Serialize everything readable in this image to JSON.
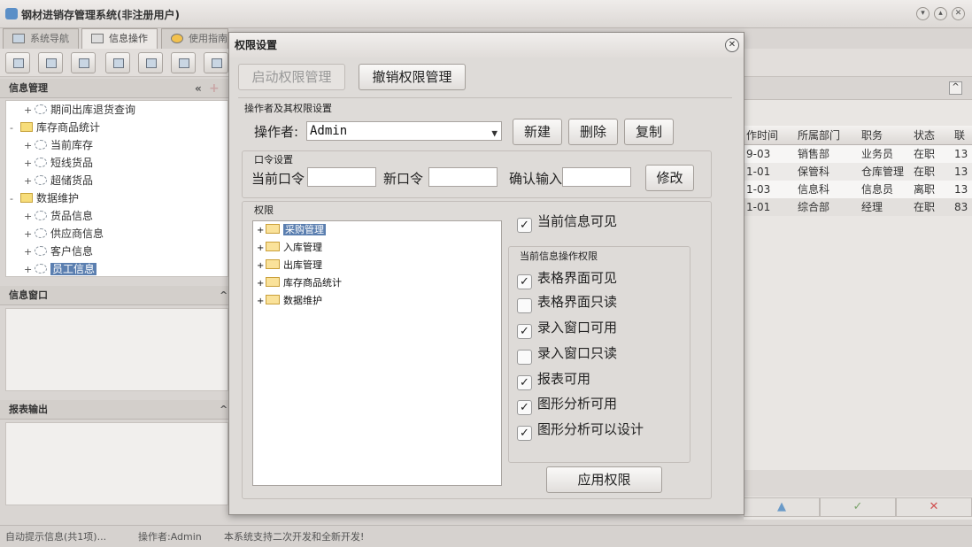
{
  "app": {
    "title": "钢材进销存管理系统(非注册用户)"
  },
  "main_tabs": [
    {
      "label": "系统导航"
    },
    {
      "label": "信息操作"
    },
    {
      "label": "使用指南"
    }
  ],
  "left": {
    "info_panel_title": "信息管理",
    "tree": [
      {
        "label": "期间出库退货查询"
      },
      {
        "label": "库存商品统计"
      },
      {
        "label": "当前库存"
      },
      {
        "label": "短线货品"
      },
      {
        "label": "超储货品"
      },
      {
        "label": "数据维护"
      },
      {
        "label": "货品信息"
      },
      {
        "label": "供应商信息"
      },
      {
        "label": "客户信息"
      },
      {
        "label": "员工信息"
      }
    ],
    "info_window_title": "信息窗口",
    "report_title": "报表输出"
  },
  "grid": {
    "headers": [
      "作时间",
      "所属部门",
      "职务",
      "状态",
      "联"
    ],
    "rows": [
      [
        "9-03",
        "销售部",
        "业务员",
        "在职",
        "13"
      ],
      [
        "1-01",
        "保管科",
        "仓库管理",
        "在职",
        "13"
      ],
      [
        "1-03",
        "信息科",
        "信息员",
        "离职",
        "13"
      ],
      [
        "1-01",
        "综合部",
        "经理",
        "在职",
        "83"
      ]
    ]
  },
  "status": {
    "hint": "自动提示信息(共1项)...",
    "operator": "操作者:Admin",
    "note": "本系统支持二次开发和全新开发!"
  },
  "dialog": {
    "title": "权限设置",
    "enable_btn": "启动权限管理",
    "revoke_btn": "撤销权限管理",
    "operator_group": "操作者及其权限设置",
    "operator_label": "操作者:",
    "operator_value": "Admin",
    "new_btn": "新建",
    "delete_btn": "删除",
    "copy_btn": "复制",
    "password_group": "口令设置",
    "current_pw_label": "当前口令",
    "new_pw_label": "新口令",
    "confirm_label": "确认输入",
    "modify_btn": "修改",
    "perm_group": "权限",
    "perm_tree": [
      {
        "label": "采购管理"
      },
      {
        "label": "入库管理"
      },
      {
        "label": "出库管理"
      },
      {
        "label": "库存商品统计"
      },
      {
        "label": "数据维护"
      }
    ],
    "current_visible": {
      "label": "当前信息可见",
      "checked": true
    },
    "ops_group": "当前信息操作权限",
    "ops": [
      {
        "label": "表格界面可见",
        "checked": true
      },
      {
        "label": "表格界面只读",
        "checked": false
      },
      {
        "label": "录入窗口可用",
        "checked": true
      },
      {
        "label": "录入窗口只读",
        "checked": false
      },
      {
        "label": "报表可用",
        "checked": true
      },
      {
        "label": "图形分析可用",
        "checked": true
      },
      {
        "label": "图形分析可以设计",
        "checked": true
      }
    ],
    "apply_btn": "应用权限"
  }
}
